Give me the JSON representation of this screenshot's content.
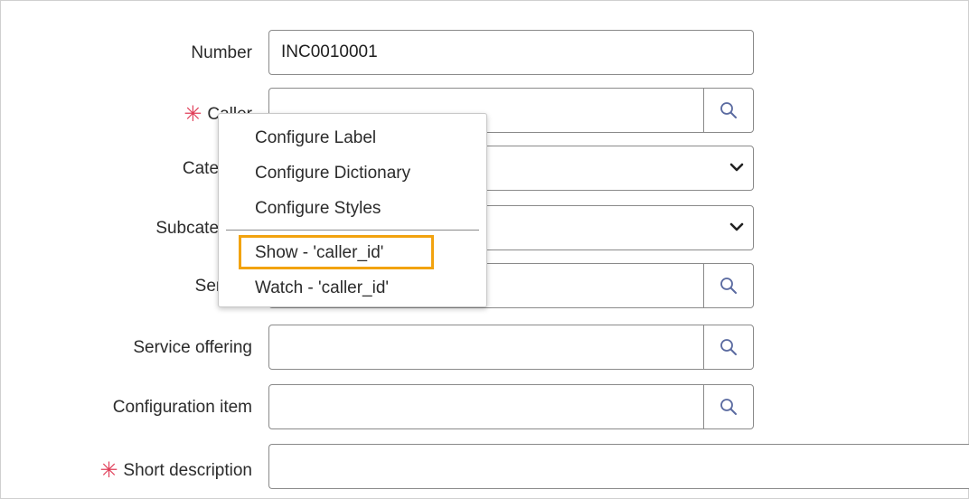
{
  "form": {
    "number": {
      "label": "Number",
      "value": "INC0010001"
    },
    "caller": {
      "label": "Caller",
      "required": true,
      "value": ""
    },
    "category": {
      "label": "Category",
      "value": ""
    },
    "subcategory": {
      "label": "Subcategory",
      "value": ""
    },
    "service": {
      "label": "Service",
      "value": ""
    },
    "service_offering": {
      "label": "Service offering",
      "value": ""
    },
    "configuration_item": {
      "label": "Configuration item",
      "value": ""
    },
    "short_description": {
      "label": "Short description",
      "required": true,
      "value": ""
    },
    "required_marker": "✳"
  },
  "context_menu": {
    "items": [
      {
        "label": "Configure Label"
      },
      {
        "label": "Configure Dictionary"
      },
      {
        "label": "Configure Styles"
      },
      {
        "label": "Show - 'caller_id'",
        "highlighted": true
      },
      {
        "label": "Watch - 'caller_id'"
      }
    ]
  },
  "icons": {
    "lookup": "search-icon",
    "dropdown": "chevron-down-icon"
  },
  "colors": {
    "required": "#e0405a",
    "highlight": "#f2a30f",
    "field_border": "#8a8a8a",
    "icon": "#5a6aa0"
  }
}
